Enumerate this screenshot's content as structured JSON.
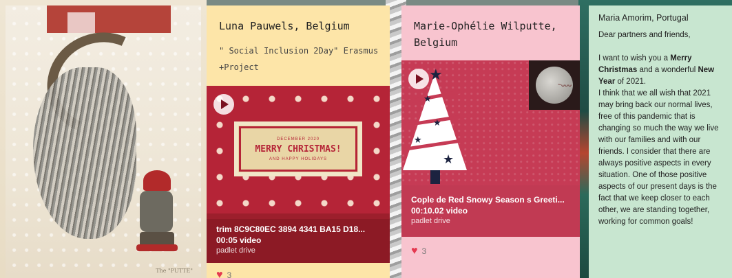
{
  "cards": [
    {
      "author": "Luna Pauwels, Belgium",
      "subject": "\" Social Inclusion 2Day\" Erasmus +Project",
      "video": {
        "banner_top": "DECEMBER 2020",
        "banner_main": "MERRY CHRISTMAS!",
        "banner_bottom": "AND HAPPY HOLIDAYS",
        "title": "trim 8C9C80EC 3894 4341 BA15 D18...",
        "duration": "00:05 video",
        "source": "padlet drive"
      },
      "likes": "3"
    },
    {
      "author": "Marie-Ophélie Wilputte, Belgium",
      "video": {
        "title": "Cople de Red Snowy Season s Greeti...",
        "duration": "00:10.02 video",
        "source": "padlet drive"
      },
      "likes": "3"
    },
    {
      "author": "Maria Amorim, Portugal",
      "greeting": "Dear partners and friends,",
      "paragraph1_pre": "I want to wish you a ",
      "paragraph1_bold1": "Merry Christmas",
      "paragraph1_mid": " and a wonderful ",
      "paragraph1_bold2": "New Year",
      "paragraph1_post": " of 2021.",
      "paragraph2": "I think that we all wish that 2021 may bring back our normal lives, free of this pandemic that is changing so much the way we live with our families and with our friends. I consider that there are always positive aspects in every situation. One of those positive aspects of our present days is the fact that we keep closer to each other, we are standing together, working for common goals!"
    }
  ],
  "illustration": {
    "caption": "The \"PUTTE\""
  },
  "colors": {
    "card1_bg": "#fde5a8",
    "card2_bg": "#f8c4cf",
    "card3_bg": "#c8e6d0",
    "heart": "#e53950"
  }
}
